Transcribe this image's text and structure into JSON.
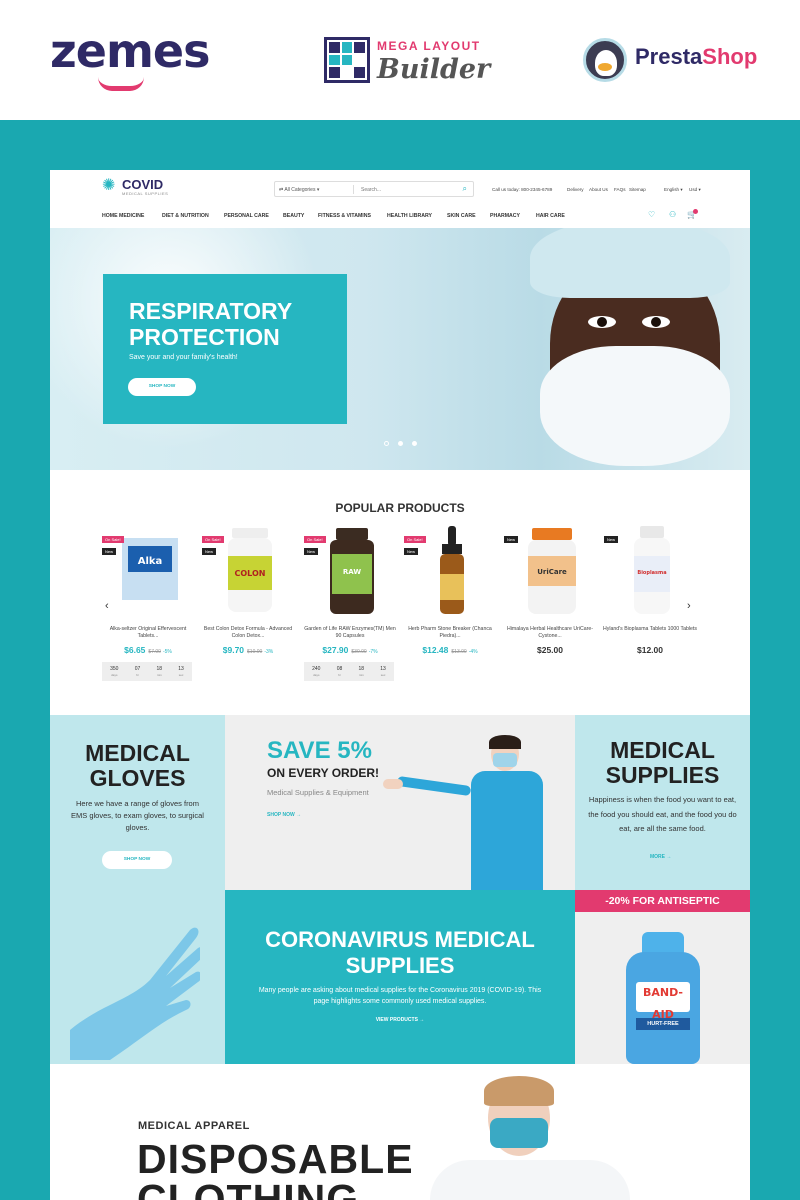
{
  "brands": {
    "zemes": "zemes",
    "mlb_top": "MEGA LAYOUT",
    "mlb_bottom": "Builder",
    "presta_a": "Presta",
    "presta_b": "Shop"
  },
  "header": {
    "logo_title": "COVID",
    "logo_sub": "MEDICAL SUPPLIES",
    "search_category": "All Categories",
    "search_placeholder": "Search...",
    "call": "Call us today: 800-2345-6789",
    "links": [
      "Delivery",
      "About Us",
      "FAQs",
      "Sitemap"
    ],
    "lang": "English",
    "currency": "Usd"
  },
  "nav": [
    "HOME MEDICINE",
    "DIET & NUTRITION",
    "PERSONAL CARE",
    "BEAUTY",
    "FITNESS & VITAMINS",
    "HEALTH LIBRARY",
    "SKIN CARE",
    "PHARMACY",
    "HAIR CARE"
  ],
  "icons": {
    "search": "search-icon",
    "wishlist": "heart-icon",
    "account": "user-icon",
    "cart": "cart-icon",
    "logo": "virus-icon"
  },
  "hero": {
    "title": "RESPIRATORY PROTECTION",
    "subtitle": "Save your and your family's health!",
    "button": "SHOP NOW"
  },
  "popular": {
    "title": "POPULAR PRODUCTS",
    "items": [
      {
        "name": "Alka-seltzer Original Effervescent Tablets...",
        "price": "$6.65",
        "old": "$7.00",
        "pct": "-5%",
        "badges": [
          "On Sale!",
          "New"
        ]
      },
      {
        "name": "Best Colon Detox Formula - Advanced Colon Detox...",
        "price": "$9.70",
        "old": "$10.00",
        "pct": "-3%",
        "badges": [
          "On Sale!",
          "New"
        ]
      },
      {
        "name": "Garden of Life RAW Enzymes(TM) Men 90 Capsules",
        "price": "$27.90",
        "old": "$30.00",
        "pct": "-7%",
        "badges": [
          "On Sale!",
          "New"
        ]
      },
      {
        "name": "Herb Pharm Stone Breaker (Chanca Piedra)...",
        "price": "$12.48",
        "old": "$13.00",
        "pct": "-4%",
        "badges": [
          "On Sale!",
          "New"
        ]
      },
      {
        "name": "Himalaya Herbal Healthcare UriCare-Cystone...",
        "price": "$25.00",
        "old": "",
        "pct": "",
        "badges": [
          "New"
        ]
      },
      {
        "name": "Hyland's Bioplasma Tablets 1000 Tablets",
        "price": "$12.00",
        "old": "",
        "pct": "",
        "badges": [
          "New"
        ]
      }
    ],
    "timer1": {
      "days": "350",
      "hrs": "07",
      "min": "18",
      "sec": "13"
    },
    "timer2": {
      "days": "240",
      "hrs": "08",
      "min": "18",
      "sec": "13"
    },
    "timer_units": {
      "d": "days",
      "h": "hr",
      "m": "min",
      "s": "sec"
    }
  },
  "gloves": {
    "title": "MEDICAL GLOVES",
    "text": "Here we have a range of gloves from EMS gloves, to exam gloves, to surgical gloves.",
    "button": "SHOP NOW"
  },
  "save": {
    "title": "SAVE 5%",
    "subtitle": "ON EVERY ORDER!",
    "text": "Medical Supplies & Equipment",
    "link": "SHOP NOW →"
  },
  "supplies": {
    "title": "MEDICAL SUPPLIES",
    "text": "Happiness is when the food you want to eat, the food you should eat, and the food you do eat, are all the same food.",
    "link": "MORE →"
  },
  "corona": {
    "title": "CORONAVIRUS MEDICAL SUPPLIES",
    "text": "Many people are asking about medical supplies for the Coronavirus 2019 (COVID-19). This page highlights some commonly used medical supplies.",
    "link": "VIEW PRODUCTS →"
  },
  "antiseptic": {
    "tag": "-20% FOR ANTISEPTIC",
    "brand": "BAND-AID",
    "maker": "Johnson&Johnson",
    "hurt": "HURT-FREE"
  },
  "apparel": {
    "sub": "MEDICAL APPAREL",
    "title": "DISPOSABLE CLOTHING"
  },
  "colors": {
    "accent": "#26b6c1",
    "pink": "#e23a6f",
    "navy": "#2f2a66",
    "outer": "#1aa8b0"
  }
}
